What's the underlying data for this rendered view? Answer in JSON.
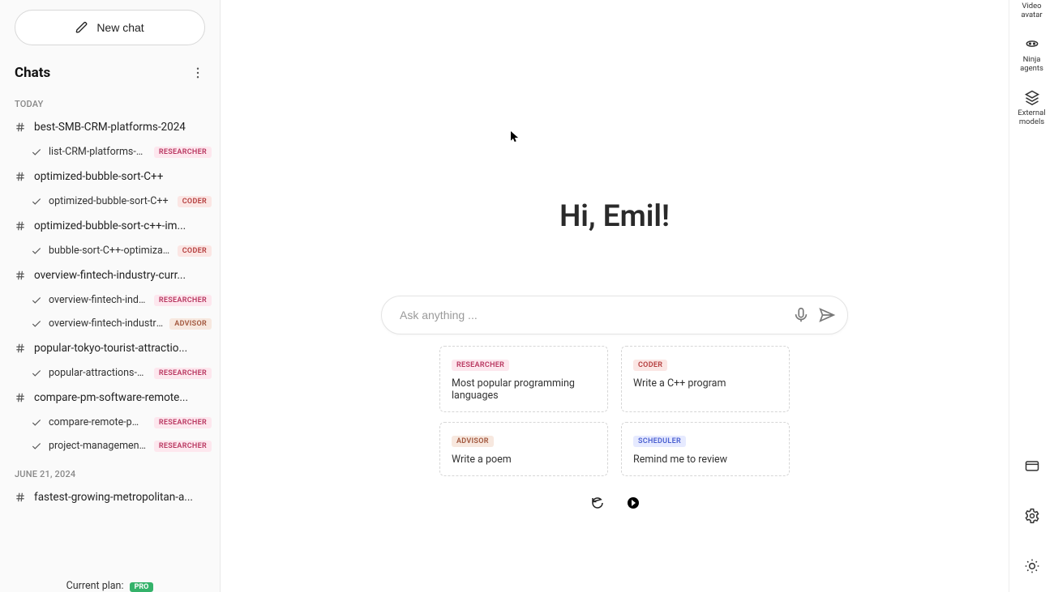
{
  "sidebar": {
    "new_chat": "New chat",
    "chats_heading": "Chats",
    "group_today": "TODAY",
    "group_jun21": "JUNE 21, 2024",
    "threads": [
      {
        "title": "best-SMB-CRM-platforms-2024",
        "subs": [
          {
            "label": "list-CRM-platforms-SM...",
            "tag": "RESEARCHER"
          }
        ]
      },
      {
        "title": "optimized-bubble-sort-C++",
        "subs": [
          {
            "label": "optimized-bubble-sort-C++",
            "tag": "CODER"
          }
        ]
      },
      {
        "title": "optimized-bubble-sort-c++-im...",
        "subs": [
          {
            "label": "bubble-sort-C++-optimization",
            "tag": "CODER"
          }
        ]
      },
      {
        "title": "overview-fintech-industry-curr...",
        "subs": [
          {
            "label": "overview-fintech-industry",
            "tag": "RESEARCHER"
          },
          {
            "label": "overview-fintech-industry-...",
            "tag": "ADVISOR"
          }
        ]
      },
      {
        "title": "popular-tokyo-tourist-attractio...",
        "subs": [
          {
            "label": "popular-attractions-Tok...",
            "tag": "RESEARCHER"
          }
        ]
      },
      {
        "title": "compare-pm-software-remote...",
        "subs": [
          {
            "label": "compare-remote-pm-s...",
            "tag": "RESEARCHER"
          },
          {
            "label": "project-management-s...",
            "tag": "RESEARCHER"
          }
        ]
      }
    ],
    "jun21_thread": "fastest-growing-metropolitan-a...",
    "plan_label": "Current plan:",
    "plan_name": "PRO"
  },
  "main": {
    "greeting": "Hi, Emil!",
    "ask_placeholder": "Ask anything ...",
    "suggestions": [
      {
        "tag": "RESEARCHER",
        "text": "Most popular programming languages"
      },
      {
        "tag": "CODER",
        "text": "Write a C++ program"
      },
      {
        "tag": "ADVISOR",
        "text": "Write a poem"
      },
      {
        "tag": "SCHEDULER",
        "text": "Remind me to review"
      }
    ]
  },
  "rail": {
    "video": "Video avatar",
    "ninja": "Ninja agents",
    "external": "External models"
  }
}
